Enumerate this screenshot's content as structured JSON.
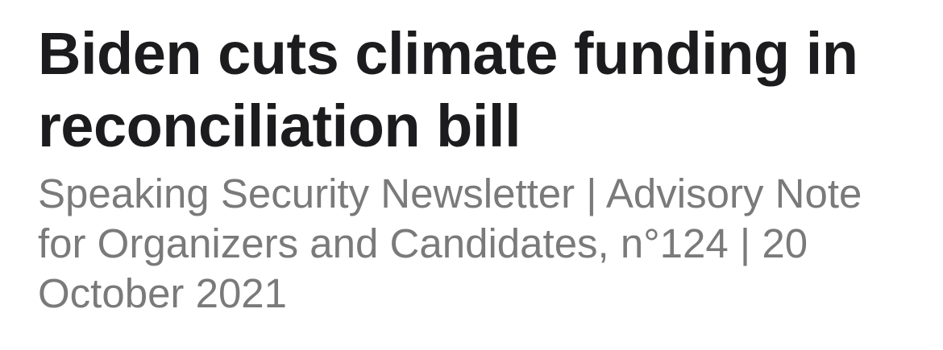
{
  "article": {
    "title": "Biden cuts climate funding in reconciliation bill",
    "subtitle": "Speaking Security Newsletter | Advisory Note for Organizers and Candidates, n°124 | 20 October 2021"
  },
  "colors": {
    "title": "#1c1c1e",
    "subtitle": "#7a7a7a",
    "background": "#ffffff"
  }
}
